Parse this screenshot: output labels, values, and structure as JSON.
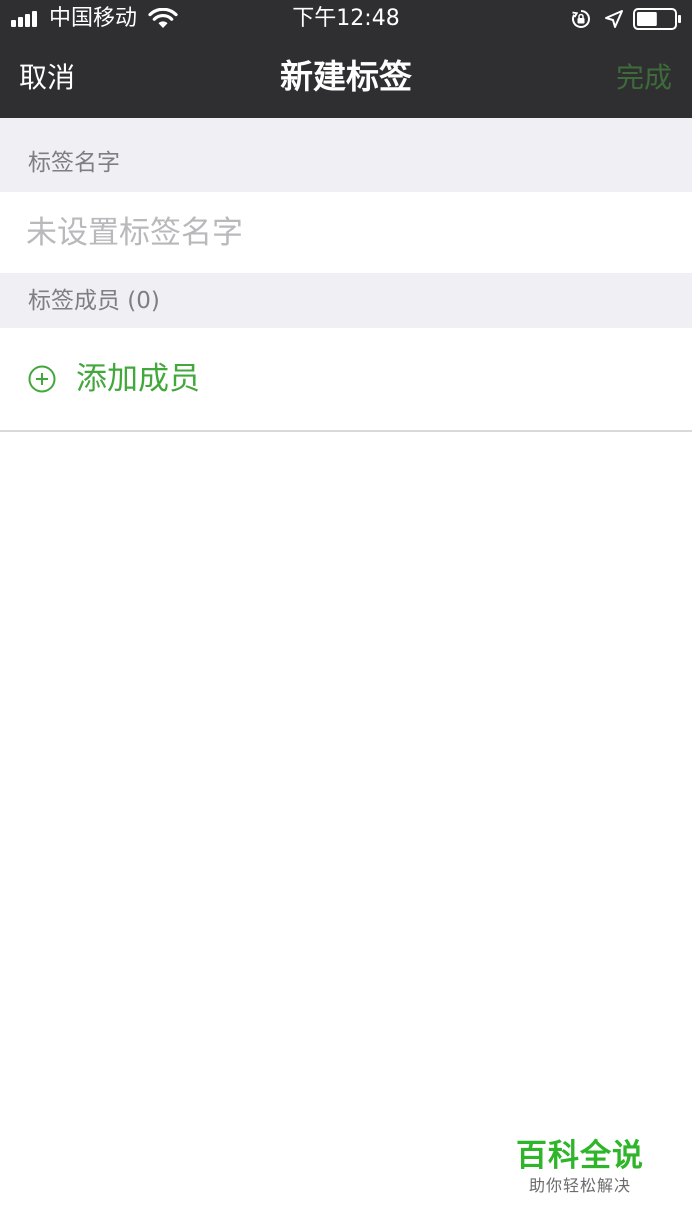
{
  "status_bar": {
    "carrier": "中国移动",
    "time": "下午12:48",
    "battery_level": 0.55
  },
  "nav": {
    "cancel_label": "取消",
    "title": "新建标签",
    "done_label": "完成"
  },
  "form": {
    "name_header": "标签名字",
    "name_placeholder": "未设置标签名字",
    "name_value": "",
    "members_header": "标签成员 (0)",
    "add_member_label": "添加成员"
  },
  "watermark": {
    "title": "百科全说",
    "subtitle": "助你轻松解决"
  },
  "colors": {
    "nav_background": "#2f2f31",
    "section_background": "#efeff4",
    "accent_green": "#43a83c",
    "done_disabled_green": "#3d6b3a",
    "watermark_green": "#2fb52a"
  },
  "icons": {
    "signal": "cellular-signal-icon",
    "wifi": "wifi-icon",
    "rotation_lock": "rotation-lock-icon",
    "location": "location-arrow-icon",
    "battery": "battery-icon",
    "add": "plus-circle-icon"
  }
}
